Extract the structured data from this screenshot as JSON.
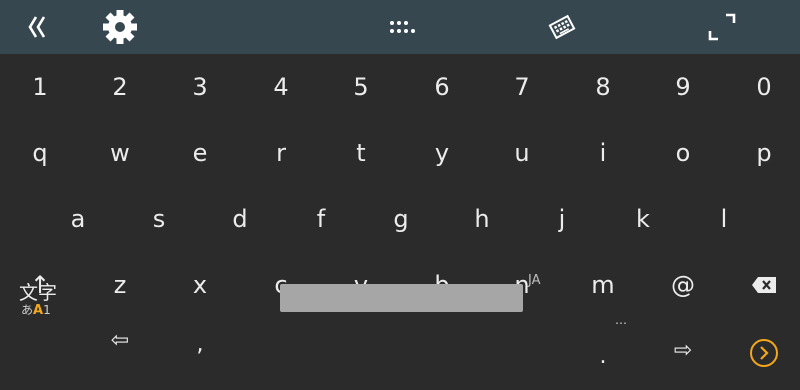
{
  "toolbar": {
    "collapse_icon": "double-chevron-left-icon",
    "settings_icon": "gear-icon",
    "handle_icon": "grip-dots-icon",
    "keyboard_icon": "keyboard-icon",
    "expand_icon": "fullscreen-icon"
  },
  "rows": {
    "numbers": [
      "1",
      "2",
      "3",
      "4",
      "5",
      "6",
      "7",
      "8",
      "9",
      "0"
    ],
    "top": [
      "q",
      "w",
      "e",
      "r",
      "t",
      "y",
      "u",
      "i",
      "o",
      "p"
    ],
    "middle": [
      "a",
      "s",
      "d",
      "f",
      "g",
      "h",
      "j",
      "k",
      "l"
    ],
    "bottom": [
      "z",
      "x",
      "c",
      "v",
      "b",
      "n",
      "m",
      "@"
    ]
  },
  "special": {
    "shift": "↑",
    "backspace_icon": "backspace-icon",
    "mode_top": "文字",
    "mode_bottom_left": "あ",
    "mode_bottom_mid": "A",
    "mode_bottom_right": "1",
    "left_arrow": "⇦",
    "comma": ",",
    "language": "JA",
    "period": ".",
    "more": "…",
    "right_arrow": "⇨",
    "go_icon": "circle-arrow-right-icon"
  },
  "colors": {
    "toolbar_bg": "#37474f",
    "keyboard_bg": "#2b2b2b",
    "accent": "#f3a81b",
    "space_bar": "#a6a6a6"
  }
}
